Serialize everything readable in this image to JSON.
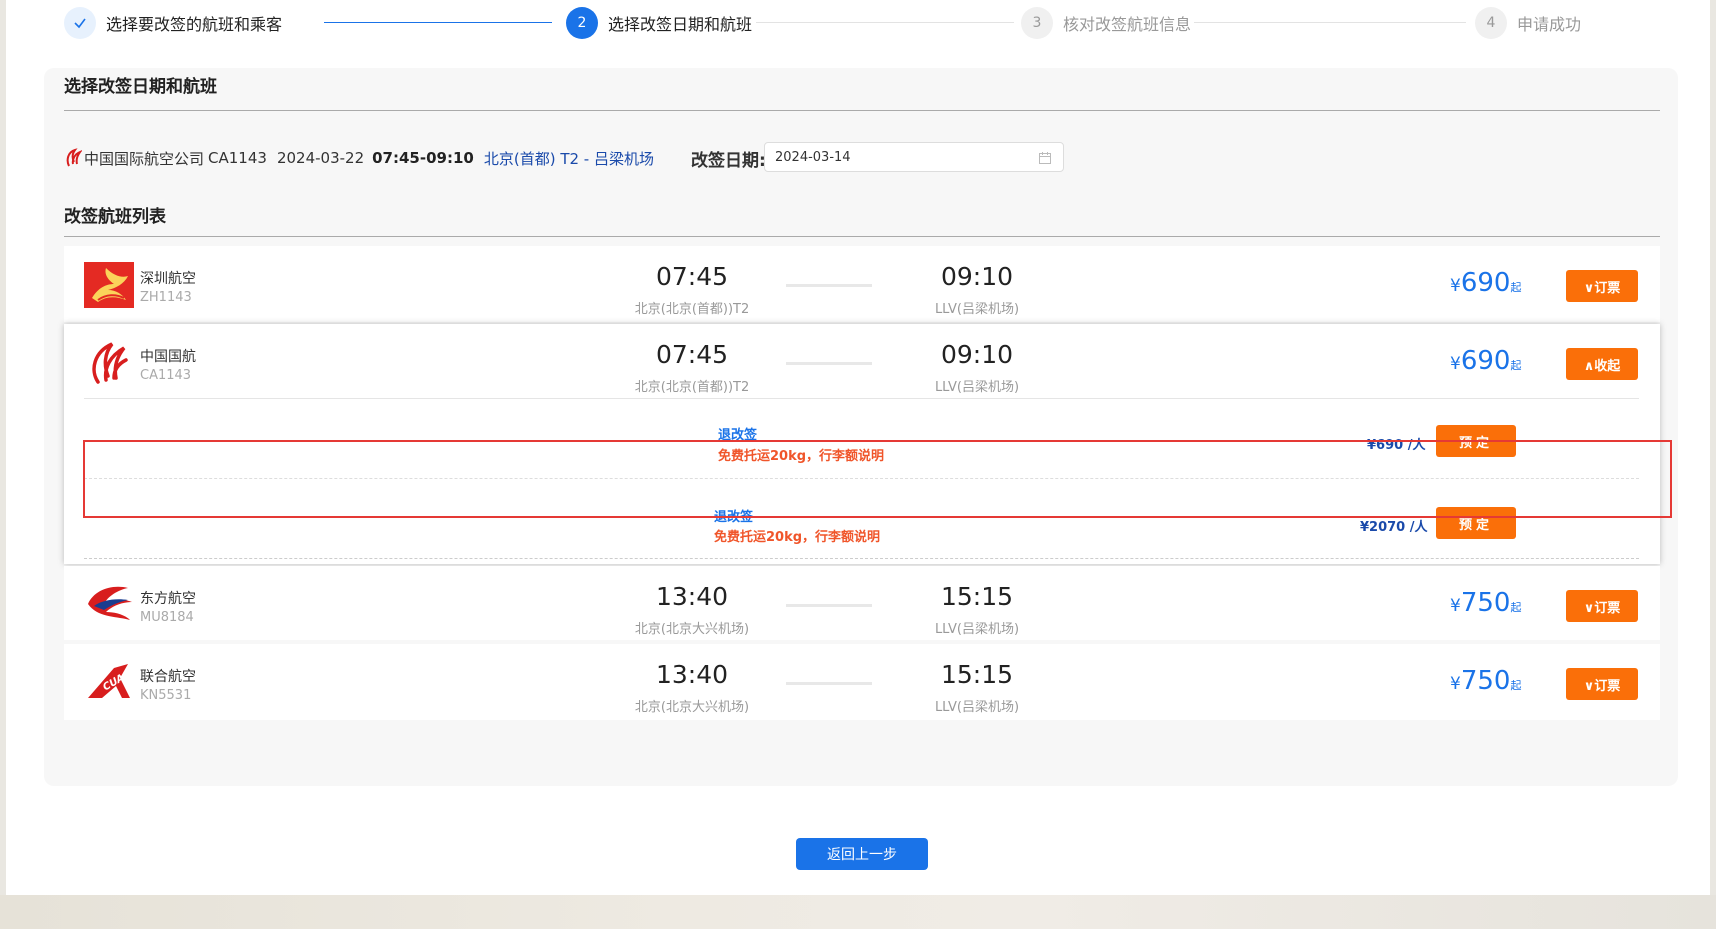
{
  "steps": [
    {
      "num": "✓",
      "label": "选择要改签的航班和乘客"
    },
    {
      "num": "2",
      "label": "选择改签日期和航班"
    },
    {
      "num": "3",
      "label": "核对改签航班信息"
    },
    {
      "num": "4",
      "label": "申请成功"
    }
  ],
  "section1_title": "选择改签日期和航班",
  "original_flight": {
    "airline": "中国国际航空公司",
    "code": "CA1143",
    "date": "2024-03-22",
    "dep_time": "07:45",
    "dash": "-",
    "arr_time": "09:10",
    "route": "北京(首都) T2 - 吕梁机场"
  },
  "change_date_label": "改签日期:",
  "change_date_value": "2024-03-14",
  "section2_title": "改签航班列表",
  "flights": [
    {
      "airline": "深圳航空",
      "code": "ZH1143",
      "dep_time": "07:45",
      "dep_airport": "北京(北京(首都))T2",
      "arr_time": "09:10",
      "arr_airport": "LLV(吕梁机场)",
      "currency": "¥",
      "price": "690",
      "suffix": "起",
      "button": "∨订票"
    },
    {
      "airline": "中国国航",
      "code": "CA1143",
      "dep_time": "07:45",
      "dep_airport": "北京(北京(首都))T2",
      "arr_time": "09:10",
      "arr_airport": "LLV(吕梁机场)",
      "currency": "¥",
      "price": "690",
      "suffix": "起",
      "button": "∧收起",
      "cabins": [
        {
          "title": "退改签",
          "desc": "免费托运20kg，行李额说明",
          "price": "¥690 /人",
          "button": "预定"
        },
        {
          "title": "退改签",
          "desc": "免费托运20kg，行李额说明",
          "price": "¥2070 /人",
          "button": "预定"
        }
      ]
    },
    {
      "airline": "东方航空",
      "code": "MU8184",
      "dep_time": "13:40",
      "dep_airport": "北京(北京大兴机场)",
      "arr_time": "15:15",
      "arr_airport": "LLV(吕梁机场)",
      "currency": "¥",
      "price": "750",
      "suffix": "起",
      "button": "∨订票"
    },
    {
      "airline": "联合航空",
      "code": "KN5531",
      "dep_time": "13:40",
      "dep_airport": "北京(北京大兴机场)",
      "arr_time": "15:15",
      "arr_airport": "LLV(吕梁机场)",
      "currency": "¥",
      "price": "750",
      "suffix": "起",
      "button": "∨订票"
    }
  ],
  "back_button": "返回上一步",
  "colors": {
    "primary": "#1a73e8",
    "orange": "#fa6f09",
    "highlight": "#e53935",
    "price_blue": "#1a73e8",
    "baggage_red": "#f0552a"
  },
  "icons": {
    "step1": "check-icon",
    "date": "calendar-icon",
    "airlines": [
      "shenzhen-airlines-logo",
      "air-china-logo",
      "china-eastern-logo",
      "china-united-logo"
    ]
  }
}
